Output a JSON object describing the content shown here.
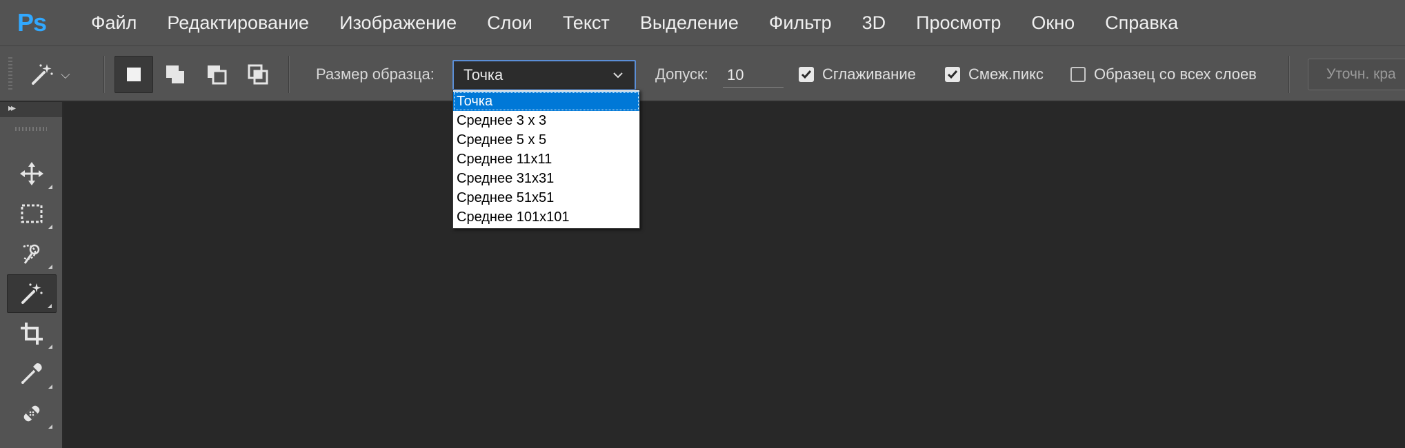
{
  "app": {
    "logo": "Ps",
    "accent_color": "#31a8ff",
    "menu": [
      "Файл",
      "Редактирование",
      "Изображение",
      "Слои",
      "Текст",
      "Выделение",
      "Фильтр",
      "3D",
      "Просмотр",
      "Окно",
      "Справка"
    ]
  },
  "options_bar": {
    "tool_preset_icon": "magic-wand-icon",
    "selection_modes": [
      "new-selection",
      "add-to-selection",
      "subtract-from-selection",
      "intersect-with-selection"
    ],
    "active_mode": "new-selection",
    "sample_size_label": "Размер образца:",
    "sample_size_value": "Точка",
    "tolerance_label": "Допуск:",
    "tolerance_value": "10",
    "antialias_label": "Сглаживание",
    "antialias_checked": true,
    "contiguous_label": "Смеж.пикс",
    "contiguous_checked": true,
    "sample_all_layers_label": "Образец со всех слоев",
    "sample_all_layers_checked": false,
    "refine_edge_label": "Уточн. кра"
  },
  "dropdown": {
    "items": [
      "Точка",
      "Среднее 3 x 3",
      "Среднее 5 x 5",
      "Среднее 11x11",
      "Среднее 31x31",
      "Среднее 51x51",
      "Среднее 101x101"
    ],
    "selected_index": 0,
    "highlight_color": "#0078d7"
  },
  "toolbox": {
    "tools": [
      "move-tool",
      "rectangular-marquee-tool",
      "quick-selection-tool",
      "magic-wand-tool",
      "crop-tool",
      "eyedropper-tool",
      "healing-brush-tool"
    ],
    "active_tool": "magic-wand-tool"
  }
}
